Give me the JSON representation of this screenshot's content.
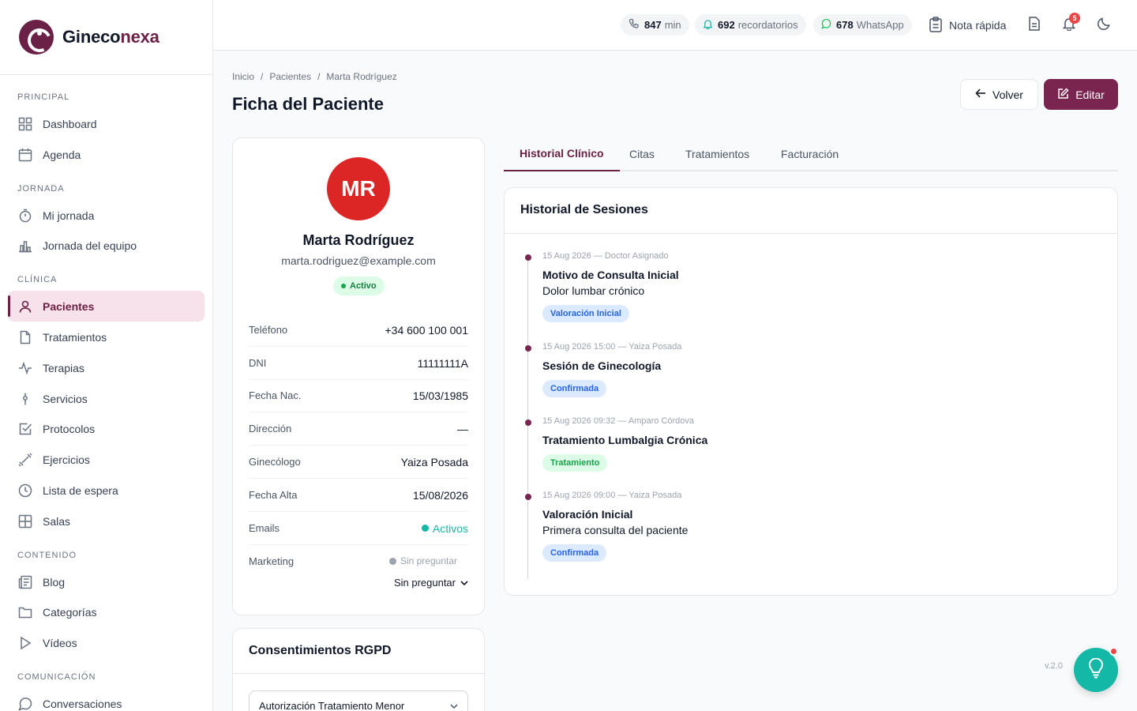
{
  "brand": {
    "name_prefix": "Gineco",
    "name_suffix": "nexa"
  },
  "sidebar": {
    "sections": [
      "PRINCIPAL",
      "JORNADA",
      "CLÍNICA",
      "CONTENIDO",
      "COMUNICACIÓN"
    ],
    "items": [
      {
        "label": "Dashboard",
        "icon": "grid-icon"
      },
      {
        "label": "Agenda",
        "icon": "calendar-icon"
      },
      {
        "label": "Mi jornada",
        "icon": "stopwatch-icon"
      },
      {
        "label": "Jornada del equipo",
        "icon": "bar-chart-icon"
      },
      {
        "label": "Pacientes",
        "icon": "user-icon"
      },
      {
        "label": "Tratamientos",
        "icon": "file-icon"
      },
      {
        "label": "Terapias",
        "icon": "activity-icon"
      },
      {
        "label": "Servicios",
        "icon": "pin-icon"
      },
      {
        "label": "Protocolos",
        "icon": "checkbox-icon"
      },
      {
        "label": "Ejercicios",
        "icon": "dumbbell-icon"
      },
      {
        "label": "Lista de espera",
        "icon": "clock-icon"
      },
      {
        "label": "Salas",
        "icon": "layout-icon"
      },
      {
        "label": "Blog",
        "icon": "newspaper-icon"
      },
      {
        "label": "Categorías",
        "icon": "folder-icon"
      },
      {
        "label": "Vídeos",
        "icon": "play-icon"
      },
      {
        "label": "Conversaciones",
        "icon": "chat-icon"
      }
    ]
  },
  "topbar": {
    "minutes_value": "847",
    "minutes_unit": "min",
    "reminders_value": "692",
    "reminders_unit": "recordatorios",
    "whatsapp_value": "678",
    "whatsapp_unit": "WhatsApp",
    "quick_note": "Nota rápida",
    "notifications_count": "5"
  },
  "breadcrumb": {
    "home": "Inicio",
    "section": "Pacientes",
    "current": "Marta Rodríguez"
  },
  "page": {
    "title": "Ficha del Paciente",
    "back_label": "Volver",
    "edit_label": "Editar"
  },
  "patient": {
    "initials": "MR",
    "name": "Marta Rodríguez",
    "email": "marta.rodriguez@example.com",
    "status": "Activo",
    "fields": [
      {
        "label": "Teléfono",
        "value": "+34 600 100 001"
      },
      {
        "label": "DNI",
        "value": "11111111A"
      },
      {
        "label": "Fecha Nac.",
        "value": "15/03/1985"
      },
      {
        "label": "Dirección",
        "value": "—"
      },
      {
        "label": "Ginecólogo",
        "value": "Yaiza Posada"
      },
      {
        "label": "Fecha Alta",
        "value": "15/08/2026"
      },
      {
        "label": "Emails",
        "value": "Activos"
      }
    ],
    "marketing_label": "Marketing",
    "marketing_status": "Sin preguntar",
    "marketing_select": "Sin preguntar"
  },
  "consent": {
    "title": "Consentimientos RGPD",
    "select_value": "Autorización Tratamiento Menor"
  },
  "tabs": [
    "Historial Clínico",
    "Citas",
    "Tratamientos",
    "Facturación"
  ],
  "sessions": {
    "title": "Historial de Sesiones",
    "items": [
      {
        "meta": "15 Aug 2026 — Doctor Asignado",
        "title": "Motivo de Consulta Inicial",
        "desc": "Dolor lumbar crónico",
        "tag": "Valoración Inicial",
        "tag_color": "#2563eb"
      },
      {
        "meta": "15 Aug 2026 15:00 — Yaiza Posada",
        "title": "Sesión de Ginecología",
        "desc": "",
        "tag": "Confirmada",
        "tag_color": "#2563eb"
      },
      {
        "meta": "15 Aug 2026 09:32 — Amparo Córdova",
        "title": "Tratamiento Lumbalgia Crónica",
        "desc": "",
        "tag": "Tratamiento",
        "tag_color": "#16a34a"
      },
      {
        "meta": "15 Aug 2026 09:00 — Yaiza Posada",
        "title": "Valoración Inicial",
        "desc": "Primera consulta del paciente",
        "tag": "Confirmada",
        "tag_color": "#2563eb"
      }
    ]
  },
  "version": "v.2.0",
  "colors": {
    "brand": "#6b2145",
    "primary_button": "#7a2550",
    "help_fab": "#14b8a6"
  }
}
